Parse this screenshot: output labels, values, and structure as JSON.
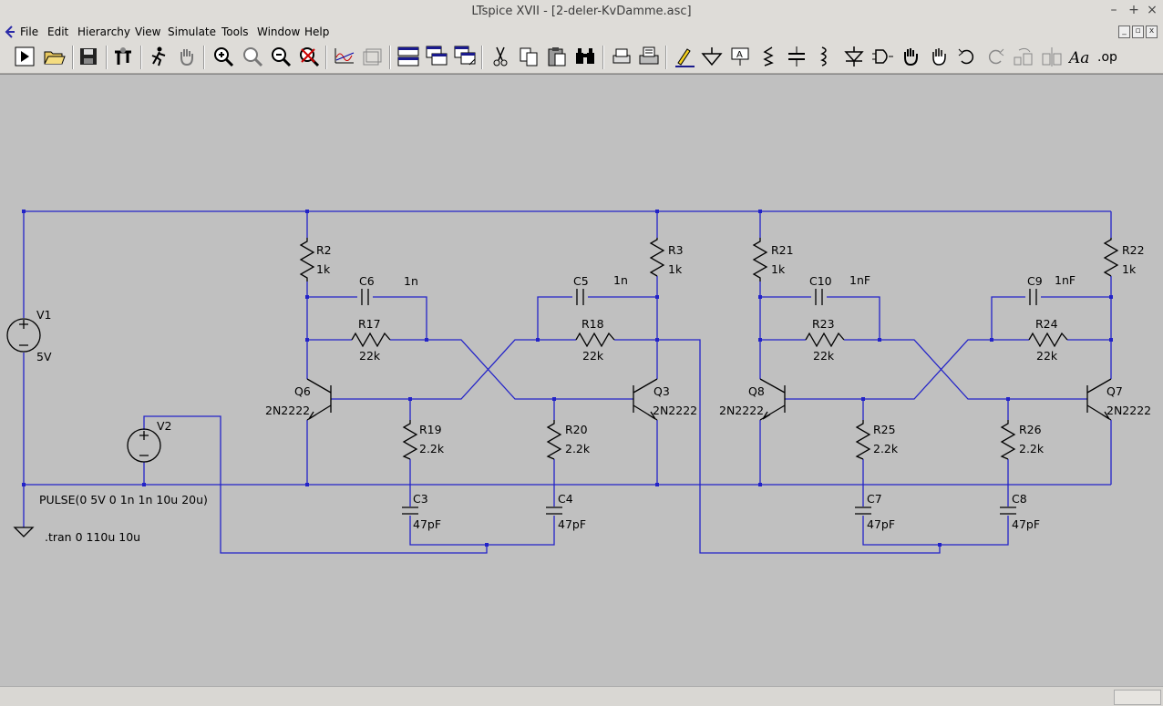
{
  "window": {
    "title": "LTspice XVII - [2-deler-KvDamme.asc]",
    "controls": {
      "minimize": "–",
      "maximize": "+",
      "close": "×"
    }
  },
  "menu": {
    "items": [
      "File",
      "Edit",
      "Hierarchy",
      "View",
      "Simulate",
      "Tools",
      "Window",
      "Help"
    ]
  },
  "toolbar": {
    "icons": [
      "run-icon",
      "open-icon",
      "save-icon",
      "control-panel-icon",
      "halt-icon",
      "pan-hand-icon",
      "zoom-in-icon",
      "zoom-area-icon",
      "zoom-out-icon",
      "zoom-fit-icon",
      "waveform-icon",
      "waveform-3d-icon",
      "tile-horizontal-icon",
      "cascade-icon",
      "tile-vertical-icon",
      "cut-icon",
      "copy-icon",
      "paste-icon",
      "find-icon",
      "print-preview-icon",
      "print-icon",
      "draw-wire-icon",
      "ground-icon",
      "label-net-icon",
      "resistor-icon",
      "capacitor-icon",
      "inductor-icon",
      "diode-icon",
      "component-icon",
      "move-icon",
      "drag-icon",
      "undo-icon",
      "redo-icon",
      "rotate-icon",
      "mirror-icon",
      "text-icon",
      "spice-directive-icon"
    ],
    "spice_directive_label": ".op",
    "text_label": "Aa"
  },
  "schematic": {
    "wire_color": "#2323c8",
    "components": {
      "V1": {
        "name": "V1",
        "value": "5V"
      },
      "V2": {
        "name": "V2",
        "value": "PULSE(0 5V 0 1n 1n 10u 20u)"
      },
      "directive": ".tran 0 110u 10u",
      "R2": {
        "name": "R2",
        "value": "1k"
      },
      "R3": {
        "name": "R3",
        "value": "1k"
      },
      "R21": {
        "name": "R21",
        "value": "1k"
      },
      "R22": {
        "name": "R22",
        "value": "1k"
      },
      "C6": {
        "name": "C6",
        "value": "1n"
      },
      "C5": {
        "name": "C5",
        "value": "1n"
      },
      "C10": {
        "name": "C10",
        "value": "1nF"
      },
      "C9": {
        "name": "C9",
        "value": "1nF"
      },
      "R17": {
        "name": "R17",
        "value": "22k"
      },
      "R18": {
        "name": "R18",
        "value": "22k"
      },
      "R23": {
        "name": "R23",
        "value": "22k"
      },
      "R24": {
        "name": "R24",
        "value": "22k"
      },
      "Q6": {
        "name": "Q6",
        "value": "2N2222"
      },
      "Q3": {
        "name": "Q3",
        "value": "2N2222"
      },
      "Q8": {
        "name": "Q8",
        "value": "2N2222"
      },
      "Q7": {
        "name": "Q7",
        "value": "2N2222"
      },
      "R19": {
        "name": "R19",
        "value": "2.2k"
      },
      "R20": {
        "name": "R20",
        "value": "2.2k"
      },
      "R25": {
        "name": "R25",
        "value": "2.2k"
      },
      "R26": {
        "name": "R26",
        "value": "2.2k"
      },
      "C3": {
        "name": "C3",
        "value": "47pF"
      },
      "C4": {
        "name": "C4",
        "value": "47pF"
      },
      "C7": {
        "name": "C7",
        "value": "47pF"
      },
      "C8": {
        "name": "C8",
        "value": "47pF"
      }
    }
  }
}
